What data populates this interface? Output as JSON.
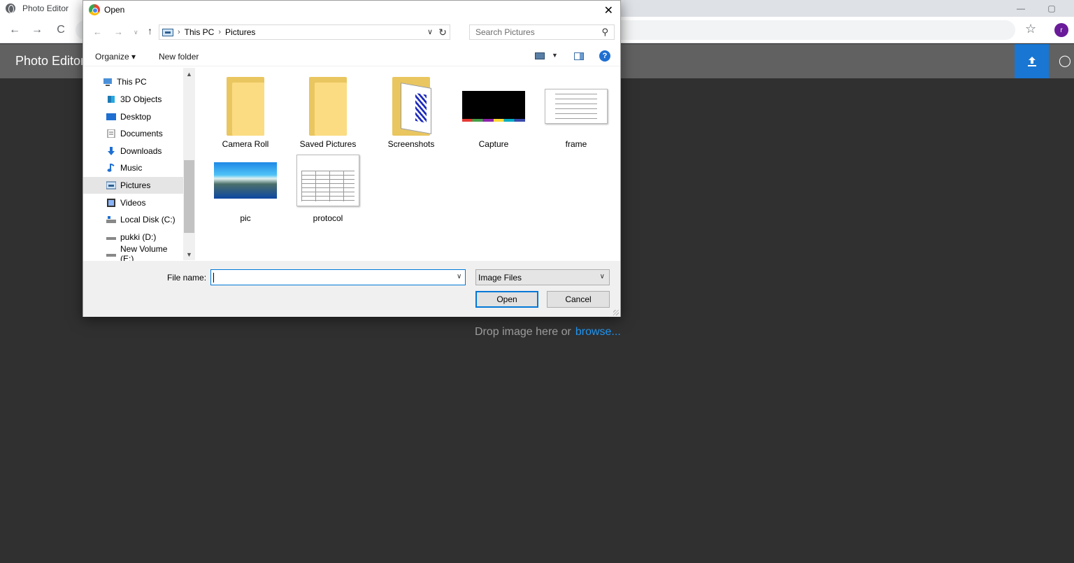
{
  "browser": {
    "tab_title": "Photo Editor",
    "back_icon": "←",
    "forward_icon": "→",
    "reload_icon": "C",
    "star_icon": "☆",
    "profile_initial": "r",
    "minimize_icon": "—",
    "restore_icon": "▢"
  },
  "app": {
    "title": "Photo Editor",
    "upload_icon": "upload-icon",
    "github_icon": "github-icon",
    "dropzone_text": "Drop image here or",
    "browse_label": "browse..."
  },
  "dialog": {
    "title": "Open",
    "close_icon": "✕",
    "breadcrumb": [
      "This PC",
      "Pictures"
    ],
    "search_placeholder": "Search Pictures",
    "organize_label": "Organize ▾",
    "new_folder_label": "New folder",
    "help_label": "?",
    "nav_items": [
      {
        "label": "This PC",
        "icon": "computer-icon"
      },
      {
        "label": "3D Objects",
        "icon": "cube-icon"
      },
      {
        "label": "Desktop",
        "icon": "desktop-icon"
      },
      {
        "label": "Documents",
        "icon": "document-icon"
      },
      {
        "label": "Downloads",
        "icon": "download-icon"
      },
      {
        "label": "Music",
        "icon": "music-icon"
      },
      {
        "label": "Pictures",
        "icon": "pictures-icon",
        "selected": true
      },
      {
        "label": "Videos",
        "icon": "video-icon"
      },
      {
        "label": "Local Disk (C:)",
        "icon": "drive-icon"
      },
      {
        "label": "pukki (D:)",
        "icon": "drive-icon"
      },
      {
        "label": "New Volume (E:)",
        "icon": "drive-icon"
      }
    ],
    "files": [
      {
        "label": "Camera Roll",
        "kind": "folder"
      },
      {
        "label": "Saved Pictures",
        "kind": "folder"
      },
      {
        "label": "Screenshots",
        "kind": "folder-with-doc"
      },
      {
        "label": "Capture",
        "kind": "image"
      },
      {
        "label": "frame",
        "kind": "image"
      },
      {
        "label": "pic",
        "kind": "image"
      },
      {
        "label": "protocol",
        "kind": "image"
      }
    ],
    "file_name_label": "File name:",
    "file_name_value": "",
    "file_type": "Image Files",
    "open_button": "Open",
    "cancel_button": "Cancel"
  }
}
